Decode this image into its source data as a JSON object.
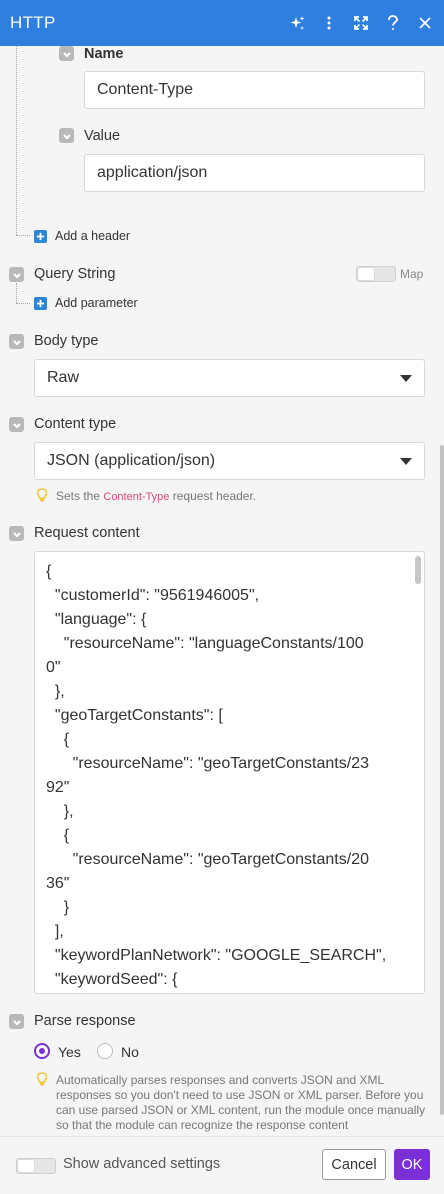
{
  "header": {
    "title": "HTTP",
    "icons": [
      "sparkle-icon",
      "more-vertical-icon",
      "expand-icon",
      "help-icon",
      "close-icon"
    ]
  },
  "headers_section": {
    "name_label": "Name",
    "name_value": "Content-Type",
    "value_label": "Value",
    "value_value": "application/json",
    "add_header": "Add a header"
  },
  "query_string": {
    "label": "Query String",
    "map_label": "Map",
    "add_parameter": "Add parameter"
  },
  "body_type": {
    "label": "Body type",
    "selected": "Raw"
  },
  "content_type": {
    "label": "Content type",
    "selected": "JSON (application/json)",
    "hint_prefix": "Sets the ",
    "hint_code": "Content-Type",
    "hint_suffix": " request header."
  },
  "request_content": {
    "label": "Request content",
    "lines": [
      "{",
      "  \"customerId\": \"9561946005\",",
      "  \"language\": {",
      "    \"resourceName\": \"languageConstants/100",
      "0\"",
      "  },",
      "  \"geoTargetConstants\": [",
      "    {",
      "      \"resourceName\": \"geoTargetConstants/23",
      "92\"",
      "    },",
      "    {",
      "      \"resourceName\": \"geoTargetConstants/20",
      "36\"",
      "    }",
      "  ],",
      "  \"keywordPlanNetwork\": \"GOOGLE_SEARCH\",",
      "  \"keywordSeed\": {"
    ]
  },
  "parse_response": {
    "label": "Parse response",
    "yes": "Yes",
    "no": "No",
    "selected": "Yes",
    "hint": "Automatically parses responses and converts JSON and XML responses so you don't need to use JSON or XML parser. Before you can use parsed JSON or XML content, run the module once manually so that the module can recognize the response content"
  },
  "footer": {
    "advanced_label": "Show advanced settings",
    "cancel": "Cancel",
    "ok": "OK"
  },
  "colors": {
    "header_bg": "#2f7fe0",
    "accent": "#7b2fd6",
    "add_button": "#2b86d6"
  }
}
